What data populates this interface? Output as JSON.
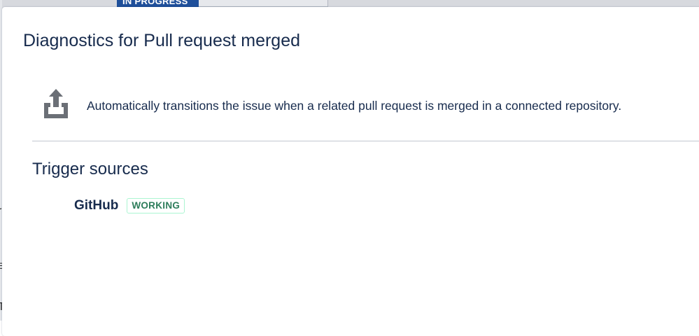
{
  "background": {
    "status_lozenge": "IN PROGRESS",
    "left_fragments": [
      "r",
      "i",
      "e",
      "T"
    ]
  },
  "modal": {
    "title": "Diagnostics for Pull request merged",
    "trigger_icon": "share-upload-icon",
    "description": "Automatically transitions the issue when a related pull request is merged in a connected repository.",
    "trigger_sources_heading": "Trigger sources",
    "sources": [
      {
        "name": "GitHub",
        "status": "WORKING",
        "status_color": "#2e7d5b"
      }
    ]
  },
  "colors": {
    "text_primary": "#172b4d",
    "divider": "#c1c7d0",
    "status_in_progress_bg": "#1f4f9a",
    "working_border": "#abf5d1"
  }
}
